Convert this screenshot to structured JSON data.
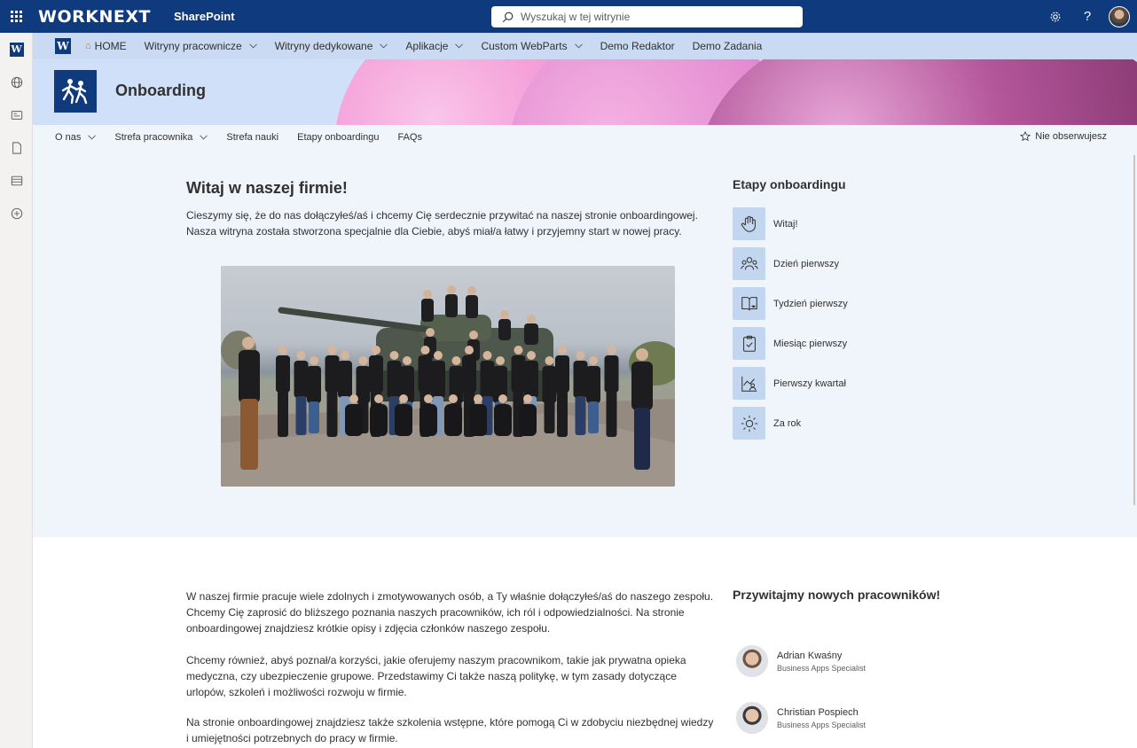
{
  "suite": {
    "brand": "WORKNEXT",
    "product": "SharePoint",
    "search_placeholder": "Wyszukaj w tej witrynie"
  },
  "hub": {
    "items": [
      {
        "label": "HOME",
        "dropdown": false
      },
      {
        "label": "Witryny pracownicze",
        "dropdown": true
      },
      {
        "label": "Witryny dedykowane",
        "dropdown": true
      },
      {
        "label": "Aplikacje",
        "dropdown": true
      },
      {
        "label": "Custom WebParts",
        "dropdown": true
      },
      {
        "label": "Demo Redaktor",
        "dropdown": false
      },
      {
        "label": "Demo Zadania",
        "dropdown": false
      }
    ]
  },
  "site": {
    "title": "Onboarding",
    "nav": [
      {
        "label": "O nas",
        "dropdown": true
      },
      {
        "label": "Strefa pracownika",
        "dropdown": true
      },
      {
        "label": "Strefa nauki",
        "dropdown": false
      },
      {
        "label": "Etapy onboardingu",
        "dropdown": false
      },
      {
        "label": "FAQs",
        "dropdown": false
      }
    ],
    "follow_label": "Nie obserwujesz"
  },
  "welcome": {
    "title": "Witaj w naszej firmie!",
    "text": "Cieszymy się, że do nas dołączyłeś/aś i chcemy Cię serdecznie przywitać na naszej stronie onboardingowej. Nasza witryna została stworzona specjalnie dla Ciebie, abyś miał/a łatwy i przyjemny start w nowej pracy."
  },
  "stages": {
    "title": "Etapy onboardingu",
    "items": [
      {
        "label": "Witaj!",
        "icon": "wave-hand-icon"
      },
      {
        "label": "Dzień pierwszy",
        "icon": "people-group-icon"
      },
      {
        "label": "Tydzień pierwszy",
        "icon": "book-learning-icon"
      },
      {
        "label": "Miesiąc pierwszy",
        "icon": "clipboard-check-icon"
      },
      {
        "label": "Pierwszy kwartał",
        "icon": "chart-person-icon"
      },
      {
        "label": "Za rok",
        "icon": "sun-icon"
      }
    ]
  },
  "intro": {
    "paragraphs": [
      "W naszej firmie pracuje wiele zdolnych i zmotywowanych osób, a Ty właśnie dołączyłeś/aś do naszego zespołu. Chcemy Cię zaprosić do bliższego poznania naszych pracowników, ich ról i odpowiedzialności. Na stronie onboardingowej znajdziesz krótkie opisy i zdjęcia członków naszego zespołu.",
      "Chcemy również, abyś poznał/a korzyści, jakie oferujemy naszym pracownikom, takie jak prywatna opieka medyczna, czy ubezpieczenie grupowe. Przedstawimy Ci także naszą politykę, w tym zasady dotyczące urlopów, szkoleń i możliwości rozwoju w firmie.",
      "Na stronie onboardingowej znajdziesz także szkolenia wstępne, które pomogą Ci w zdobyciu niezbędnej wiedzy i umiejętności potrzebnych do pracy w firmie."
    ]
  },
  "newcomers": {
    "title": "Przywitajmy nowych pracowników!",
    "people": [
      {
        "name": "Adrian Kwaśny",
        "role": "Business Apps Specialist"
      },
      {
        "name": "Christian Pospiech",
        "role": "Business Apps Specialist"
      }
    ]
  },
  "colors": {
    "suite_bar": "#0f3a7d",
    "hub_nav": "#c9daf2",
    "section_bg": "#f0f4fb",
    "stage_icon_bg": "#c3d6ef",
    "header_pink": "#f59fd8",
    "header_plum": "#8e3d78"
  }
}
